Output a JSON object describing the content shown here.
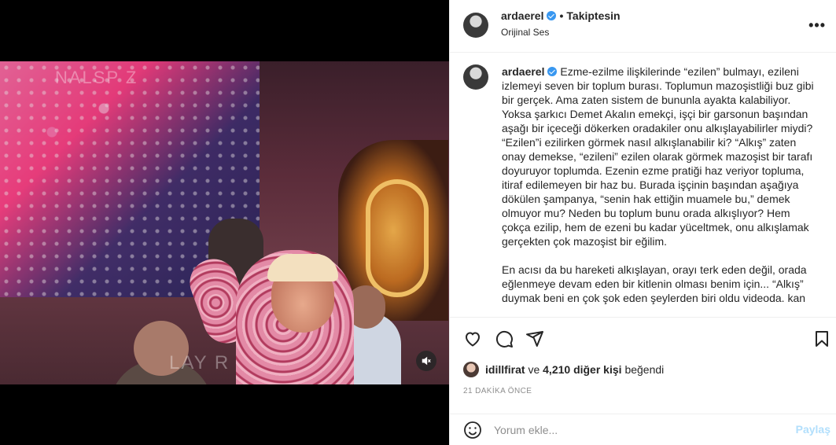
{
  "media": {
    "watermark_top": "NALSP Z",
    "watermark_mid": "LAY R",
    "mute_icon": "speaker-muted-icon"
  },
  "header": {
    "username": "ardaerel",
    "separator": "•",
    "follow_status": "Takiptesin",
    "audio": "Orijinal Ses",
    "more": "•••"
  },
  "caption": {
    "username": "ardaerel",
    "paragraph1": "Ezme-ezilme ilişkilerinde “ezilen” bulmayı, ezileni izlemeyi seven bir toplum burası. Toplumun mazoşistliği buz gibi bir gerçek. Ama zaten sistem de bununla ayakta kalabiliyor. Yoksa şarkıcı Demet Akalın emekçi, işçi bir garsonun başından aşağı bir içeceği dökerken oradakiler onu alkışlayabilirler miydi? “Ezilen”i ezilirken görmek nasıl alkışlanabilir ki? “Alkış” zaten onay demekse, “ezileni” ezilen olarak görmek mazoşist bir tarafı doyuruyor toplumda. Ezenin ezme pratiği haz veriyor topluma, itiraf edilemeyen bir haz bu. Burada işçinin başından aşağıya dökülen şampanya, “senin hak ettiğin muamele bu,” demek olmuyor mu? Neden bu toplum bunu orada alkışlıyor? Hem çokça ezilip, hem de ezeni bu kadar yüceltmek, onu alkışlamak gerçekten çok mazoşist bir eğilim.",
    "paragraph2": "En acısı da bu hareketi alkışlayan, orayı terk eden değil, orada eğlenmeye devam eden bir kitlenin olması benim için... “Alkış” duymak beni en çok şok eden şeylerden biri oldu videoda. kan"
  },
  "actions": {
    "like_icon": "heart-icon",
    "comment_icon": "comment-icon",
    "share_icon": "send-icon",
    "save_icon": "bookmark-icon"
  },
  "likes": {
    "user": "idillfirat",
    "connector": "ve",
    "count_text": "4,210 diğer kişi",
    "suffix": "beğendi"
  },
  "timestamp": "21 DAKİKA ÖNCE",
  "comment": {
    "placeholder": "Yorum ekle...",
    "post_label": "Paylaş"
  },
  "colors": {
    "verified": "#3897f0",
    "post_disabled": "#b2dffc",
    "muted_text": "#8e8e8e"
  }
}
